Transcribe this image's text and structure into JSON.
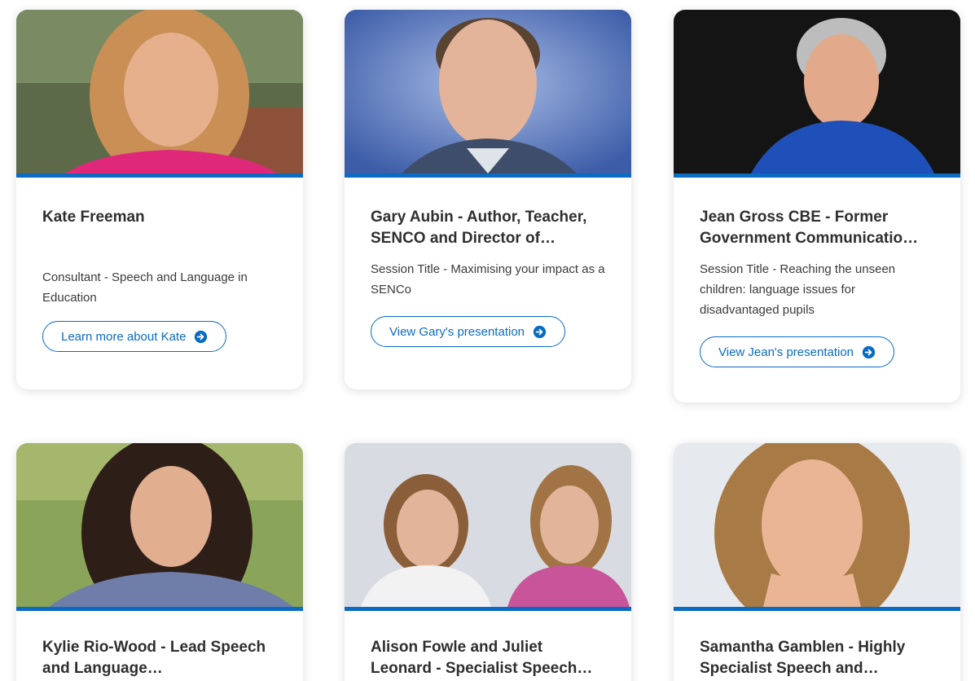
{
  "cards": [
    {
      "name": "Kate Freeman",
      "description": "Consultant - Speech and Language in Education",
      "cta": "Learn more about Kate",
      "photo": {
        "bg": "#5c6a4a",
        "skin": "#e7b08d",
        "hair": "#c98f55",
        "shirt": "#e0287a"
      }
    },
    {
      "name": "Gary Aubin - Author, Teacher, SENCO and Director of…",
      "description": "Session Title - Maximising your impact as a SENCo",
      "cta": "View Gary's presentation",
      "photo": {
        "bg": "#6b86c2",
        "skin": "#e3b49a",
        "hair": "#5b4331",
        "shirt": "#3e4e6a"
      }
    },
    {
      "name": "Jean Gross CBE - Former Government Communicatio…",
      "description": "Session Title - Reaching the unseen children: language issues for disadvantaged pupils",
      "cta": "View Jean's presentation",
      "photo": {
        "bg": "#141414",
        "skin": "#e2a98a",
        "hair": "#bdbdbd",
        "shirt": "#1f4fb8"
      }
    },
    {
      "name": "Kylie Rio-Wood - Lead Speech and Language…",
      "photo": {
        "bg": "#8aa55a",
        "skin": "#e1ae90",
        "hair": "#2e1e18",
        "shirt": "#6f7ea8"
      }
    },
    {
      "name": "Alison Fowle and Juliet Leonard - Specialist Speech…",
      "photo": {
        "bg": "#d8dbe2",
        "skin": "#e2b59a",
        "hair": "#8b5e3a",
        "shirt": "#c8559a"
      }
    },
    {
      "name": "Samantha Gamblen - Highly Specialist Speech and…",
      "photo": {
        "bg": "#e6e9ed",
        "skin": "#e9b595",
        "hair": "#a87a45",
        "shirt": "#6a6a6a"
      }
    }
  ]
}
